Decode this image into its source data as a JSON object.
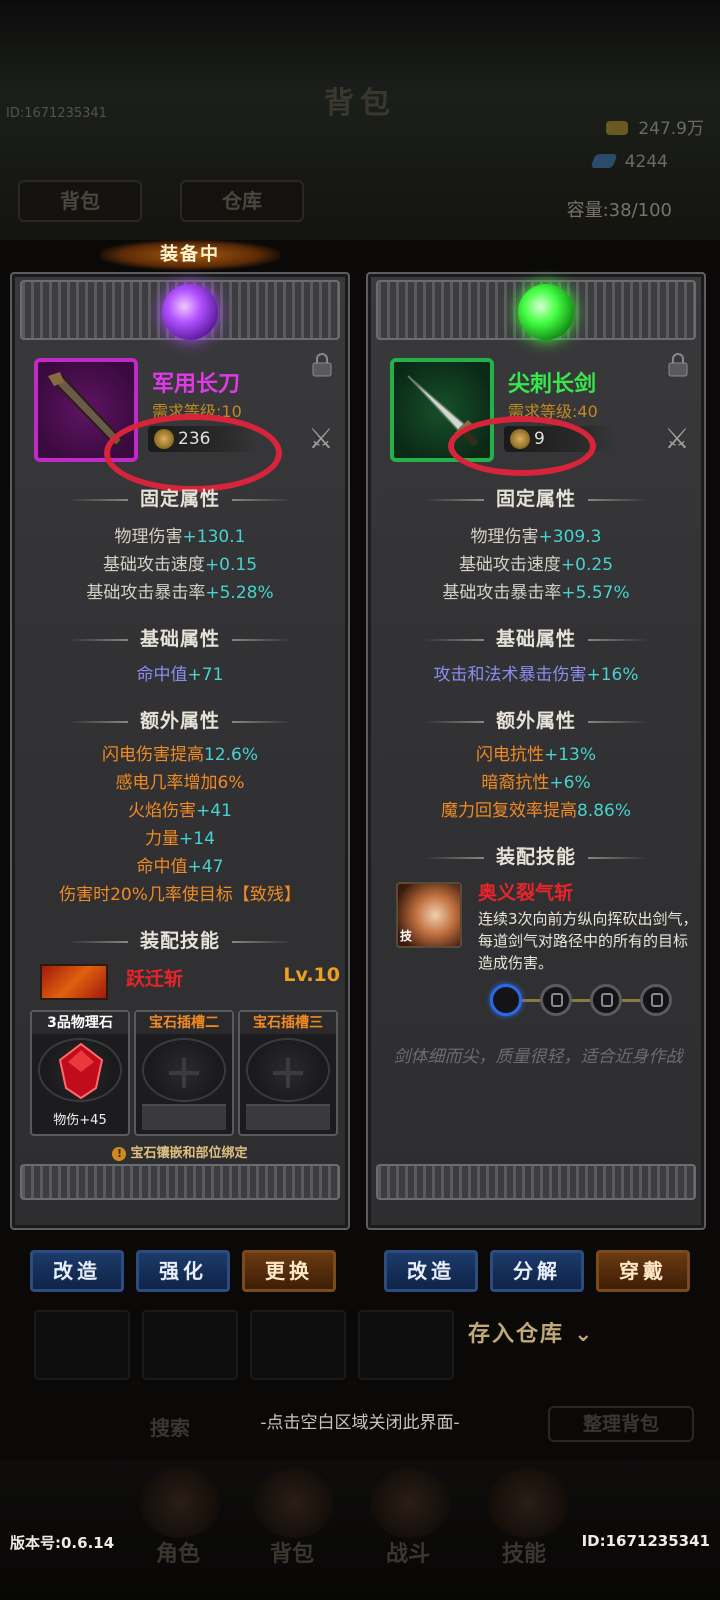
{
  "background": {
    "title": "背包",
    "id_top": "ID:1671235341",
    "gold": "247.9万",
    "gems": "4244",
    "tab_bag": "背包",
    "tab_warehouse": "仓库",
    "capacity": "容量:38/100",
    "search": "搜索",
    "sort": "整理背包",
    "nav": [
      "角色",
      "背包",
      "战斗",
      "技能"
    ]
  },
  "equipped_banner": "装备中",
  "left": {
    "name": "军用长刀",
    "req": "需求等级:10",
    "power": "236",
    "fixed_title": "固定属性",
    "fixed": [
      {
        "k": "物理伤害",
        "v": "+130.1"
      },
      {
        "k": "基础攻击速度",
        "v": "+0.15"
      },
      {
        "k": "基础攻击暴击率",
        "v": "+5.28%"
      }
    ],
    "base_title": "基础属性",
    "base": [
      {
        "k": "命中值",
        "v": "+71"
      }
    ],
    "extra_title": "额外属性",
    "extra": [
      {
        "k": "闪电伤害提高",
        "v": "12.6%"
      },
      {
        "k": "感电几率增加",
        "v": "6%"
      },
      {
        "k": "火焰伤害",
        "v": "+41"
      },
      {
        "k": "力量",
        "v": "+14"
      },
      {
        "k": "命中值",
        "v": "+47"
      },
      {
        "k": "伤害时20%几率使目标【致残】",
        "v": ""
      }
    ],
    "skill_title": "装配技能",
    "skill_name": "跃迁斩",
    "skill_level": "Lv.10",
    "gems": [
      {
        "label": "3品物理石",
        "value": "物伤+45"
      },
      {
        "label": "宝石插槽二",
        "value": ""
      },
      {
        "label": "宝石插槽三",
        "value": ""
      }
    ],
    "gem_note": "宝石镶嵌和部位绑定",
    "buttons": [
      "改造",
      "强化",
      "更换"
    ]
  },
  "right": {
    "name": "尖刺长剑",
    "req": "需求等级:40",
    "power": "9",
    "fixed_title": "固定属性",
    "fixed": [
      {
        "k": "物理伤害",
        "v": "+309.3"
      },
      {
        "k": "基础攻击速度",
        "v": "+0.25"
      },
      {
        "k": "基础攻击暴击率",
        "v": "+5.57%"
      }
    ],
    "base_title": "基础属性",
    "base": [
      {
        "k": "攻击和法术暴击伤害",
        "v": "+16%"
      }
    ],
    "extra_title": "额外属性",
    "extra": [
      {
        "k": "闪电抗性",
        "v": "+13%"
      },
      {
        "k": "暗裔抗性",
        "v": "+6%"
      },
      {
        "k": "魔力回复效率提高",
        "v": "8.86%"
      }
    ],
    "skill_title": "装配技能",
    "skill_name": "奥义裂气斩",
    "skill_tag": "技",
    "skill_desc": "连续3次向前方纵向挥砍出剑气，每道剑气对路径中的所有的目标造成伤害。",
    "flavor": "剑体细而尖，质量很轻，适合近身作战",
    "buttons": [
      "改造",
      "分解",
      "穿戴"
    ]
  },
  "store_button": "存入仓库",
  "close_hint": "-点击空白区域关闭此界面-",
  "version": "版本号:0.6.14",
  "player_id": "ID:1671235341",
  "colors": {
    "purple_quality": "#e03ae8",
    "green_quality": "#36e84a",
    "attr_value": "#47d2cf",
    "extra_key": "#f08a22",
    "skill_red": "#e8242a",
    "annotation_circle": "#d8243a"
  }
}
